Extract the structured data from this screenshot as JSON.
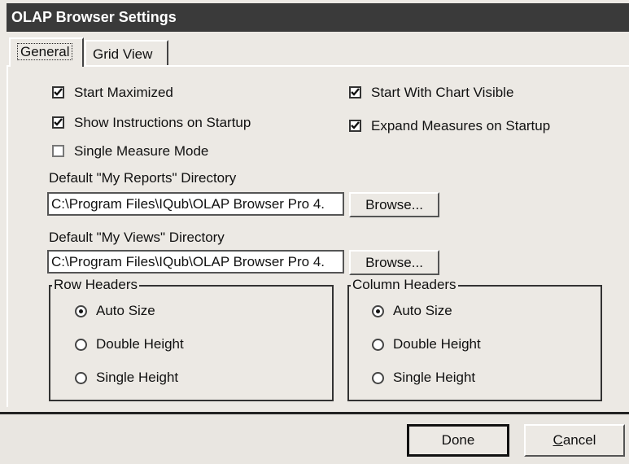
{
  "window": {
    "title": "OLAP Browser Settings"
  },
  "tabs": [
    {
      "label": "General",
      "active": true
    },
    {
      "label": "Grid View",
      "active": false
    }
  ],
  "options": {
    "start_maximized": {
      "label": "Start Maximized",
      "checked": true
    },
    "show_instructions": {
      "label": "Show Instructions on Startup",
      "checked": true
    },
    "single_measure": {
      "label": "Single Measure Mode",
      "checked": false
    },
    "start_chart": {
      "label": "Start With Chart Visible",
      "checked": true
    },
    "expand_measures": {
      "label": "Expand Measures on Startup",
      "checked": true
    }
  },
  "reports_dir": {
    "label": "Default \"My Reports\" Directory",
    "value": "C:\\Program Files\\IQub\\OLAP Browser Pro 4.",
    "browse_label": "Browse..."
  },
  "views_dir": {
    "label": "Default \"My Views\" Directory",
    "value": "C:\\Program Files\\IQub\\OLAP Browser Pro 4.",
    "browse_label": "Browse..."
  },
  "row_headers": {
    "legend": "Row Headers",
    "options": [
      "Auto Size",
      "Double Height",
      "Single Height"
    ],
    "selected": "Auto Size"
  },
  "column_headers": {
    "legend": "Column Headers",
    "options": [
      "Auto Size",
      "Double Height",
      "Single Height"
    ],
    "selected": "Auto Size"
  },
  "footer": {
    "done_label": "Done",
    "cancel_label": "Cancel"
  }
}
